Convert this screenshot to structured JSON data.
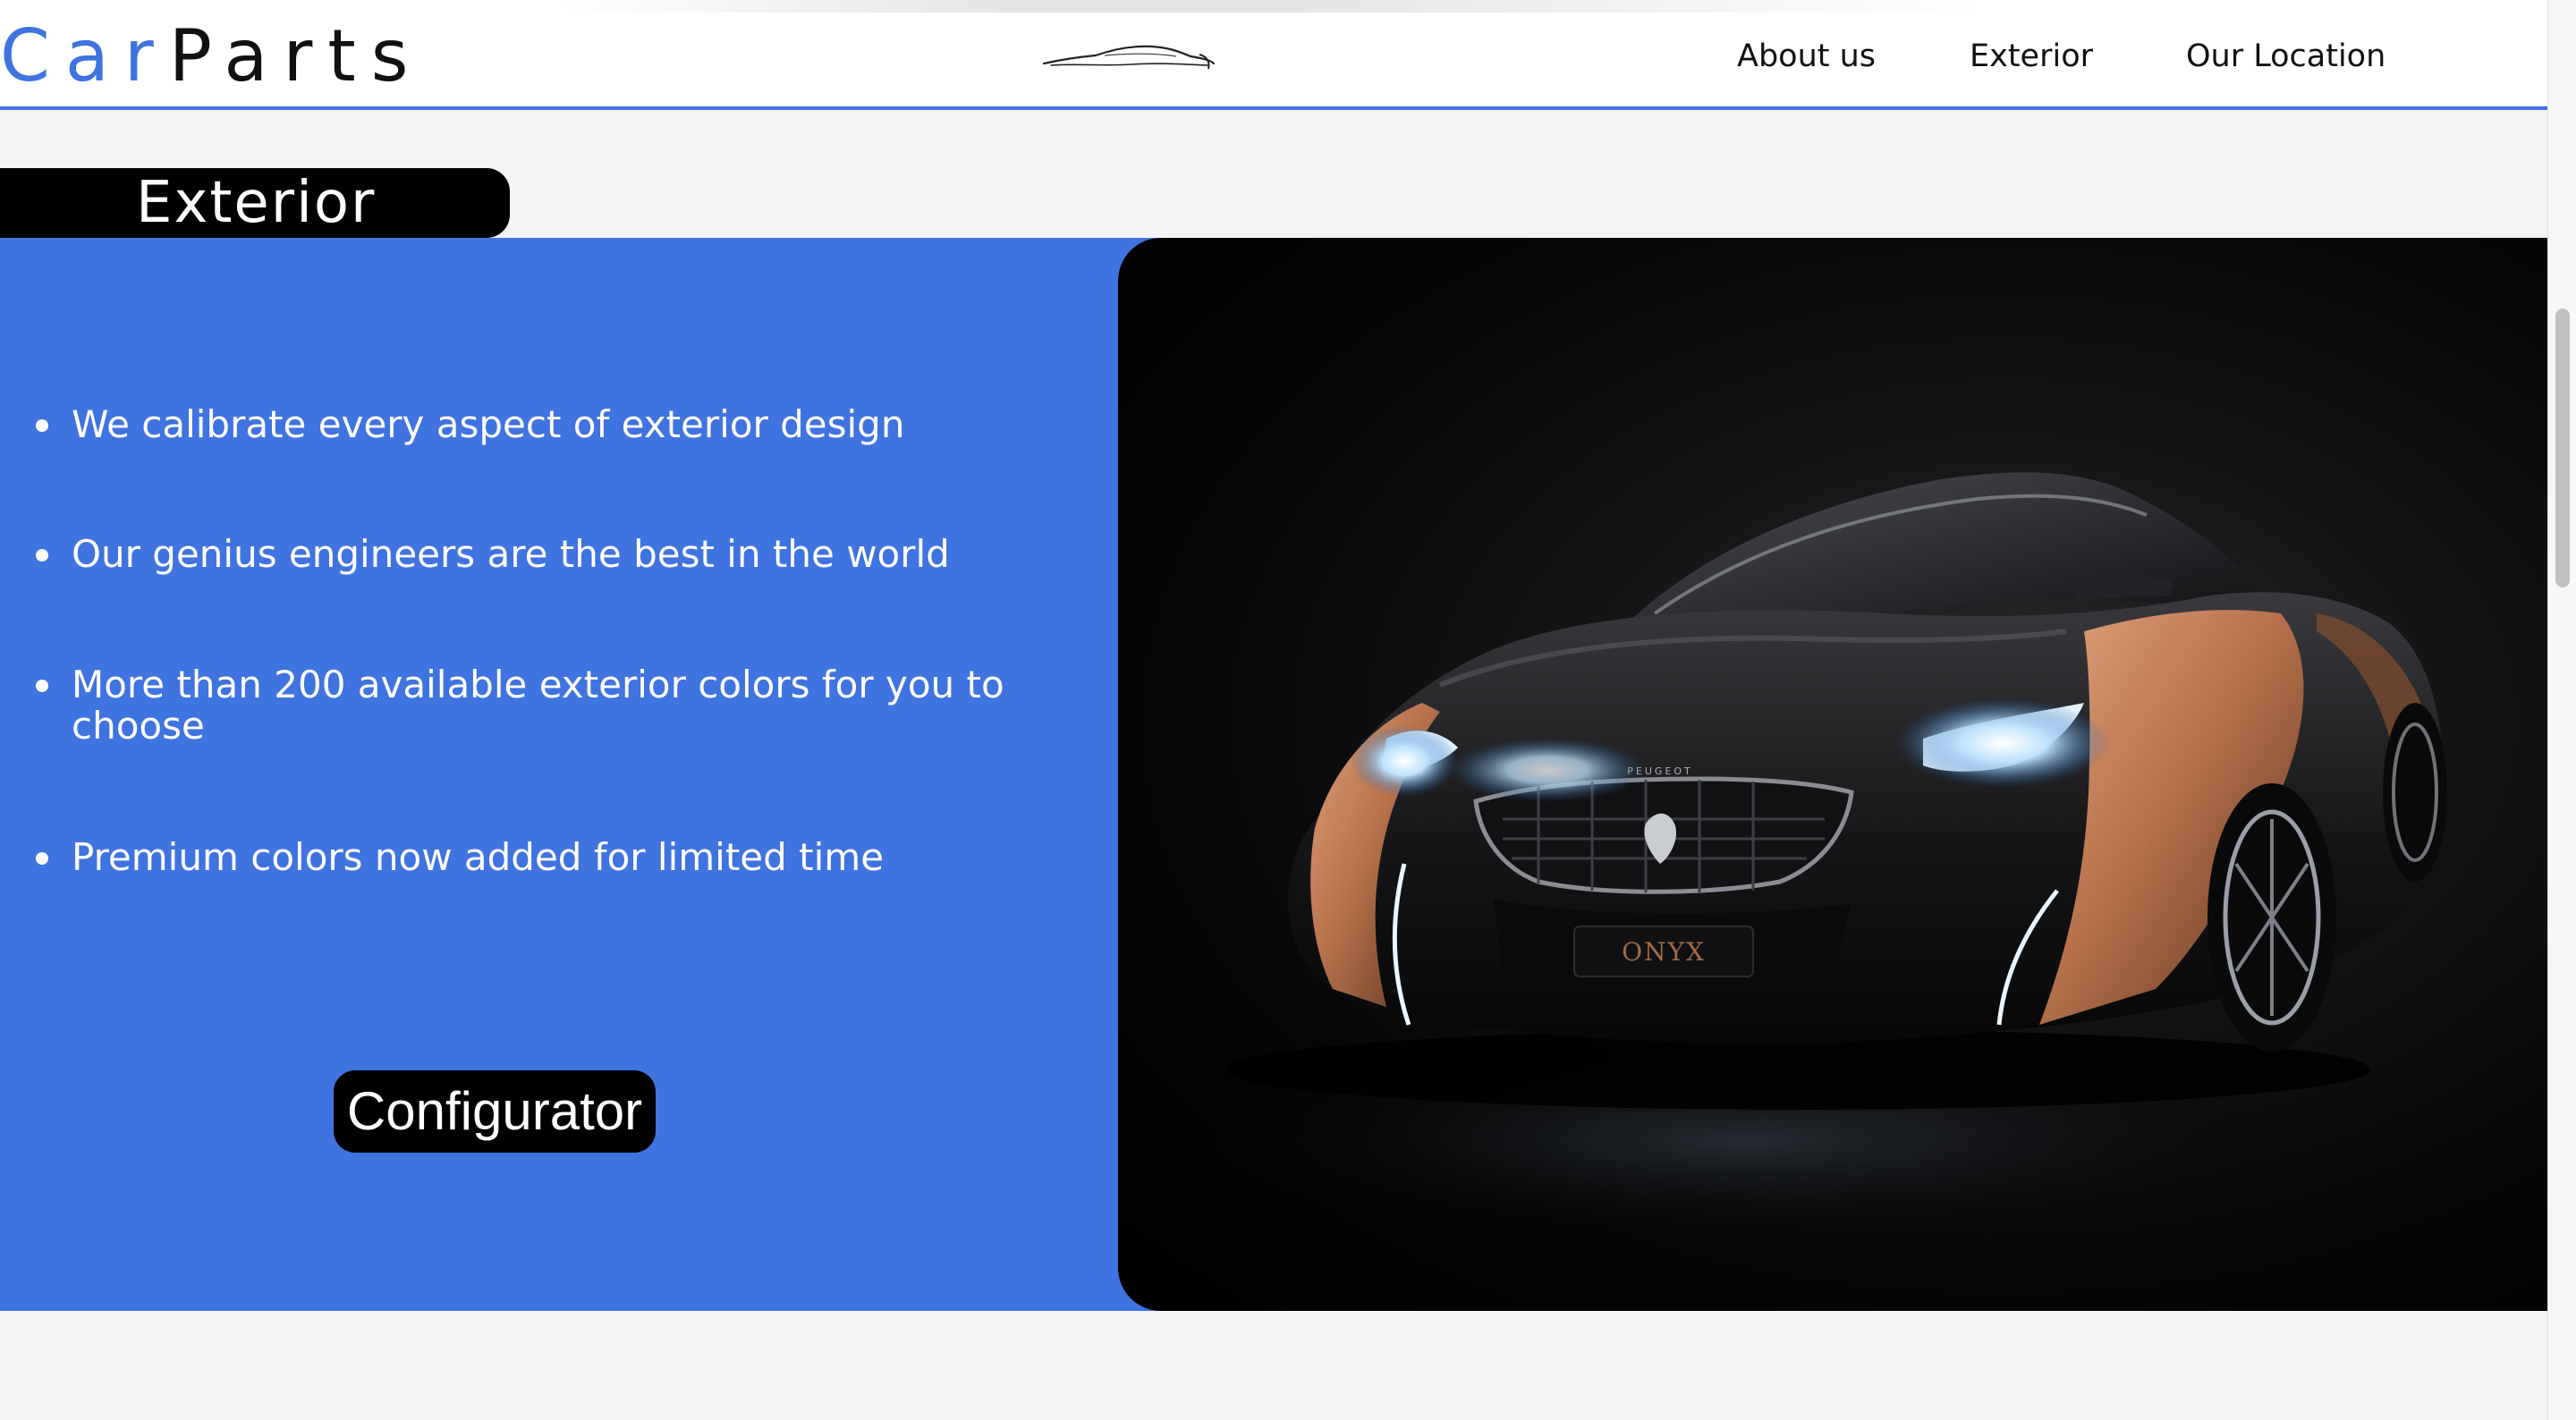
{
  "header": {
    "brand_part1": "Car",
    "brand_part2": "Parts",
    "nav": [
      {
        "label": "About us"
      },
      {
        "label": "Exterior"
      },
      {
        "label": "Our Location"
      }
    ]
  },
  "section": {
    "title": "Exterior",
    "features": [
      "We calibrate every aspect of exterior design",
      "Our genius engineers are the best in the world",
      "More than 200 available exterior colors for you to choose",
      "Premium colors now added for limited time"
    ],
    "button_label": "Configurator"
  },
  "photo": {
    "grille_badge": "PEUGEOT",
    "plate_text": "ONYX"
  },
  "colors": {
    "accent_blue": "#3f73df",
    "black": "#000000",
    "white": "#ffffff",
    "page_background": "#f3f3f3",
    "car_copper": "#b8734c"
  },
  "icons": {
    "car_logo": "car-silhouette-icon"
  }
}
